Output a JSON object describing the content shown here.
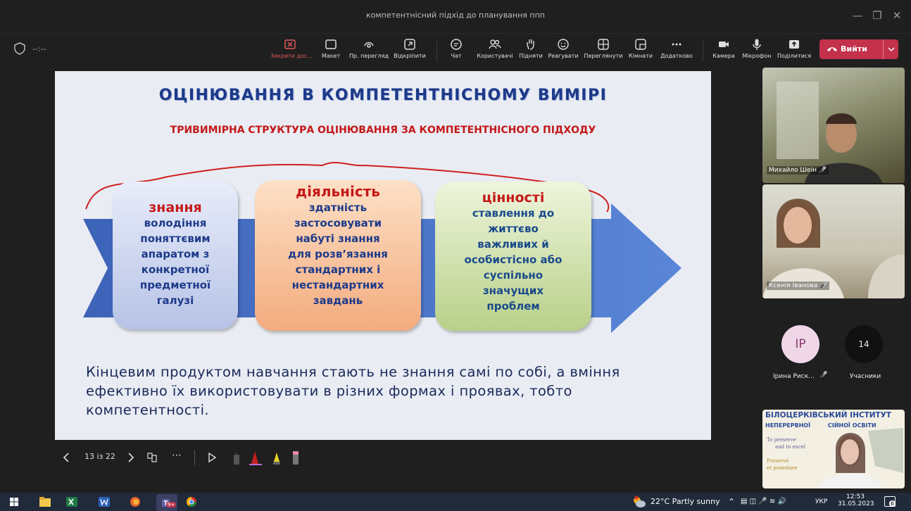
{
  "window": {
    "title": "компетентнісний підхід до планування ппп"
  },
  "toolbar": {
    "timer": "--:--",
    "buttons": [
      {
        "label": "Закрити дос...",
        "icon": "close-share-icon"
      },
      {
        "label": "Макет",
        "icon": "layout-icon"
      },
      {
        "label": "Пр. перегляд",
        "icon": "preview-icon"
      },
      {
        "label": "Відкріпити",
        "icon": "popout-icon"
      },
      {
        "label": "Чат",
        "icon": "chat-icon"
      },
      {
        "label": "Користувачі",
        "icon": "people-icon"
      },
      {
        "label": "Підняти",
        "icon": "raise-hand-icon"
      },
      {
        "label": "Реагувати",
        "icon": "react-icon"
      },
      {
        "label": "Переглянути",
        "icon": "view-icon"
      },
      {
        "label": "Кімнати",
        "icon": "rooms-icon"
      },
      {
        "label": "Додатково",
        "icon": "more-icon"
      },
      {
        "label": "Камера",
        "icon": "camera-icon"
      },
      {
        "label": "Мікрофон",
        "icon": "mic-icon"
      },
      {
        "label": "Поділитися",
        "icon": "share-icon"
      }
    ],
    "leave_label": "Вийти"
  },
  "slide": {
    "title": "ОЦІНЮВАННЯ В КОМПЕТЕНТНІСНОМУ ВИМІРІ",
    "subtitle": "ТРИВИМІРНА СТРУКТУРА ОЦІНЮВАННЯ ЗА КОМПЕТЕНТНІСНОГО ПІДХОДУ",
    "boxes": [
      {
        "heading": "знання",
        "lines": [
          "володіння",
          "поняттєвим",
          "апаратом з",
          "конкретної",
          "предметної",
          "галузі"
        ]
      },
      {
        "heading": "діяльність",
        "lines": [
          "здатність",
          "застосовувати",
          "набуті знання",
          "для розв’язання",
          "стандартних і",
          "нестандартних",
          "завдань"
        ]
      },
      {
        "heading": "цінності",
        "lines": [
          "ставлення до",
          "життєво",
          "важливих й",
          "особистісно або",
          "суспільно",
          "значущих",
          "проблем"
        ]
      }
    ],
    "bottom_text": "Кінцевим продуктом навчання стають не знання самі по собі, а вміння ефективно їх використовувати в різних формах і проявах, тобто компетентності."
  },
  "slide_controls": {
    "counter": "13 із 22"
  },
  "participants": {
    "tiles": [
      {
        "name": "Михайло Шеін"
      },
      {
        "name": "Ксенія Іванова"
      }
    ],
    "avatar_initials": "IP",
    "avatar_name": "Ірина Риск...",
    "count": "14",
    "count_label": "Учасники",
    "self_view_banner": [
      "БІЛОЦЕРКІВСЬКИЙ ІНСТИТУТ",
      "НЕПЕРЕРВНОЇ",
      "СІЙНОЇ ОСВІТИ"
    ],
    "self_view_motto": [
      "To preserve",
      "and to excel",
      "Preserve",
      "et praestare"
    ]
  },
  "taskbar": {
    "weather": "22°C  Partly sunny",
    "lang": "УКР",
    "time": "12:53",
    "date": "31.05.2023",
    "notifications": "6",
    "teams_badge": "9+"
  },
  "colors": {
    "slide_title": "#1d3a8a",
    "slide_red": "#c41818",
    "leave_button": "#c4314b",
    "avatar_ip": "#efd7e7"
  }
}
